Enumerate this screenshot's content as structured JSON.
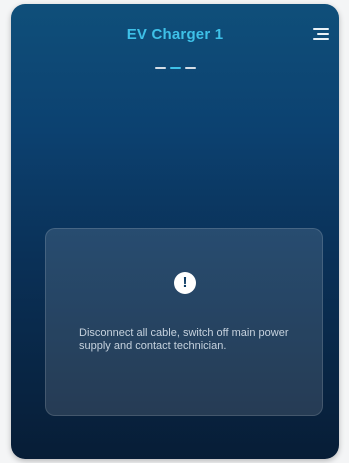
{
  "header": {
    "title": "EV Charger 1",
    "menu_icon": "hamburger-menu-icon"
  },
  "pager": {
    "count": 3,
    "active_index": 1
  },
  "alert": {
    "icon": "exclamation-icon",
    "icon_glyph": "!",
    "message": "Disconnect all cable, switch off main power supply and contact technician."
  },
  "colors": {
    "accent": "#3ec1e8",
    "background_top": "#0f4f7a",
    "background_bottom": "#071d36"
  }
}
